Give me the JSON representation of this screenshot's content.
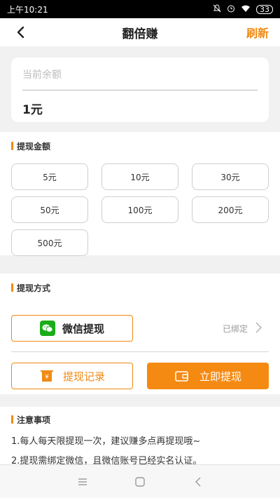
{
  "status_bar": {
    "time": "上午10:21",
    "battery": "33"
  },
  "nav": {
    "title": "翻倍赚",
    "refresh_label": "刷新"
  },
  "balance": {
    "label": "当前余额",
    "value": "1元"
  },
  "amount_section": {
    "title": "提现金额",
    "options": [
      "5元",
      "10元",
      "30元",
      "50元",
      "100元",
      "200元",
      "500元"
    ]
  },
  "method_section": {
    "title": "提现方式",
    "wechat_label": "微信提现",
    "bound_status": "已绑定",
    "record_label": "提现记录",
    "withdraw_label": "立即提现"
  },
  "notice": {
    "title": "注意事项",
    "items": [
      "1.每人每天限提现一次，建议赚多点再提现哦~",
      "2.提现需绑定微信，且微信账号已经实名认证。"
    ]
  },
  "colors": {
    "accent": "#f08a14",
    "wechat": "#1aad19"
  },
  "icons": [
    "back-arrow-icon",
    "mute-icon",
    "alarm-icon",
    "wifi-icon",
    "battery-icon",
    "wechat-icon",
    "chevron-right-icon",
    "receipt-icon",
    "wallet-icon",
    "menu-icon",
    "home-icon",
    "back-icon"
  ]
}
